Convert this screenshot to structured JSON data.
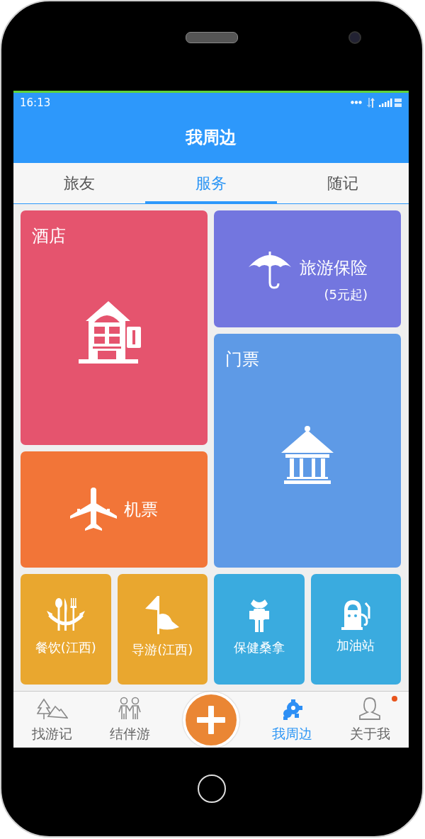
{
  "status_bar": {
    "time": "16:13"
  },
  "header": {
    "title": "我周边"
  },
  "tabs": [
    {
      "label": "旅友",
      "selected": false
    },
    {
      "label": "服务",
      "selected": true
    },
    {
      "label": "随记",
      "selected": false
    }
  ],
  "tiles": [
    {
      "kind": "hotel",
      "label": "酒店",
      "color": "#e5546e"
    },
    {
      "kind": "insurance",
      "label": "旅游保险",
      "note": "(5元起)",
      "color": "#7376df"
    },
    {
      "kind": "ticket",
      "label": "门票",
      "color": "#5e9ae6"
    },
    {
      "kind": "flight",
      "label": "机票",
      "color": "#f27538"
    },
    {
      "kind": "dining",
      "label": "餐饮(江西)",
      "color": "#e9a72f"
    },
    {
      "kind": "guide",
      "label": "导游(江西)",
      "color": "#e9a72f"
    },
    {
      "kind": "massage",
      "label": "保健桑拿",
      "color": "#3aabdf"
    },
    {
      "kind": "gas",
      "label": "加油站",
      "color": "#3aabdf"
    }
  ],
  "bottom_nav": [
    {
      "kind": "trips",
      "label": "找游记",
      "selected": false,
      "dot": false
    },
    {
      "kind": "partners",
      "label": "结伴游",
      "selected": false,
      "dot": false
    },
    {
      "kind": "add"
    },
    {
      "kind": "nearby",
      "label": "我周边",
      "selected": true,
      "dot": false
    },
    {
      "kind": "me",
      "label": "关于我",
      "selected": false,
      "dot": true
    }
  ]
}
